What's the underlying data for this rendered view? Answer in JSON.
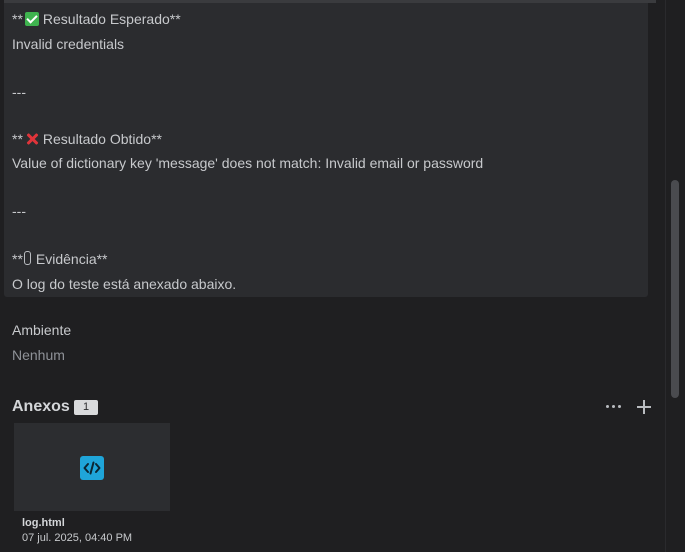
{
  "description": {
    "expected_stars_open": "**",
    "expected_heading": "Resultado Esperado**",
    "expected_value": "Invalid credentials",
    "separator1": "---",
    "obtained_stars_open": "**",
    "obtained_heading": "Resultado Obtido**",
    "obtained_value": "Value of dictionary key 'message' does not match: Invalid email or password",
    "separator2": "---",
    "evidence_stars_open": "**",
    "evidence_heading": "Evidência**",
    "evidence_value": "O log do teste está anexado abaixo."
  },
  "environment": {
    "label": "Ambiente",
    "value": "Nenhum"
  },
  "attachments": {
    "title": "Anexos",
    "count": "1",
    "items": [
      {
        "name": "log.html",
        "date": "07 jul. 2025, 04:40 PM",
        "icon": "code-file-icon"
      }
    ]
  },
  "colors": {
    "background": "#1f1f21",
    "panel": "#2b2c2f",
    "code_icon": "#1fa5d9",
    "check": "#3fb34f",
    "cross": "#e0343a"
  }
}
